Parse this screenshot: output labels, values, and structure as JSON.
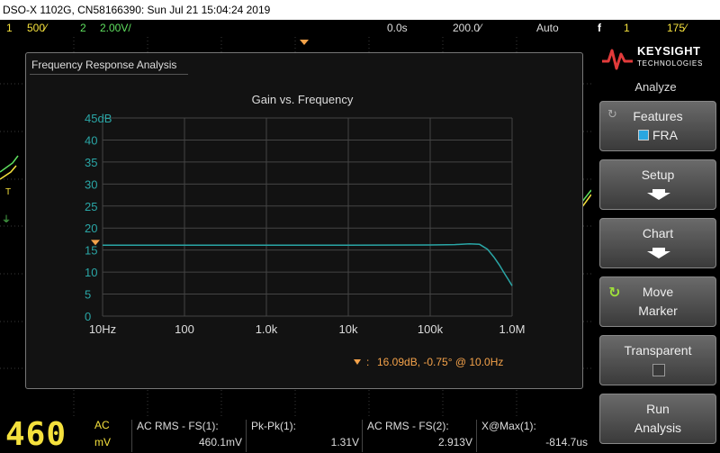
{
  "titlebar": {
    "text": "DSO-X 1102G, CN58166390: Sun Jul 21 15:04:24 2019"
  },
  "statusbar": {
    "ch1_num": "1",
    "ch1_scale": "500⁄",
    "ch2_num": "2",
    "ch2_scale": "2.00V/",
    "time_pos": "0.0s",
    "time_scale": "200.0⁄",
    "mode": "Auto",
    "trig_src": "1",
    "trig_level": "175⁄"
  },
  "panel": {
    "title": "Frequency Response Analysis"
  },
  "chart_data": {
    "type": "line",
    "title": "Gain vs. Frequency",
    "xscale": "log",
    "xlim": [
      10,
      1000000
    ],
    "ylim": [
      0,
      45
    ],
    "grid": true,
    "yticks": [
      "45dB",
      "40",
      "35",
      "30",
      "25",
      "20",
      "15",
      "10",
      "5",
      "0"
    ],
    "ytick_values": [
      45,
      40,
      35,
      30,
      25,
      20,
      15,
      10,
      5,
      0
    ],
    "xticks": [
      "10Hz",
      "100",
      "1.0k",
      "10k",
      "100k",
      "1.0M"
    ],
    "xtick_values": [
      10,
      100,
      1000,
      10000,
      100000,
      1000000
    ],
    "series": [
      {
        "color": "#2aa6a6",
        "x": [
          10,
          100,
          1000,
          10000,
          100000,
          200000,
          300000,
          400000,
          500000,
          600000,
          700000,
          800000,
          900000,
          1000000
        ],
        "y": [
          16.1,
          16.1,
          16.1,
          16.1,
          16.15,
          16.25,
          16.4,
          16.3,
          15.2,
          13.4,
          11.6,
          9.8,
          8.3,
          6.9
        ]
      }
    ],
    "marker": {
      "x": 10,
      "y": 16.09,
      "color": "#f4a24a"
    },
    "marker_readout": "16.09dB, -0.75° @ 10.0Hz",
    "marker_prefix": ":"
  },
  "sidebar": {
    "logo": "KEYSIGHT",
    "logo_sub": "TECHNOLOGIES",
    "header": "Analyze",
    "buttons": [
      {
        "line1": "Features",
        "line2": "FRA"
      },
      {
        "line1": "Setup"
      },
      {
        "line1": "Chart"
      },
      {
        "line1": "Move",
        "line2": "Marker"
      },
      {
        "line1": "Transparent"
      },
      {
        "line1": "Run",
        "line2": "Analysis"
      }
    ]
  },
  "bottom": {
    "big_value": "460",
    "unit_top": "AC",
    "unit_bottom": "mV",
    "measurements": [
      {
        "name": "AC RMS - FS(1):",
        "value": "460.1mV"
      },
      {
        "name": "Pk-Pk(1):",
        "value": "1.31V"
      },
      {
        "name": "AC RMS - FS(2):",
        "value": "2.913V"
      },
      {
        "name": "X@Max(1):",
        "value": "-814.7us"
      }
    ]
  },
  "colors": {
    "ch1": "#f5e13d",
    "ch2": "#5fe05f",
    "marker": "#f4a24a",
    "trace": "#2aa6a6"
  }
}
